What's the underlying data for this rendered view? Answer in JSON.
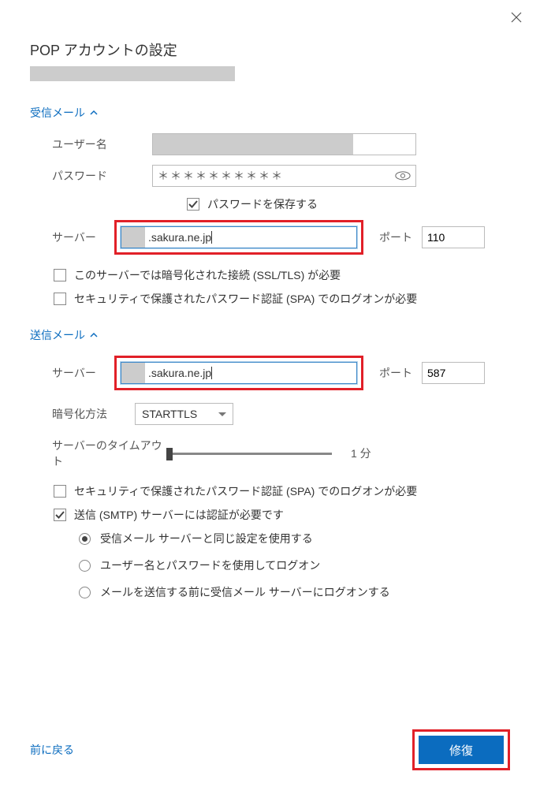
{
  "title": "POP アカウントの設定",
  "incoming": {
    "header": "受信メール",
    "username_label": "ユーザー名",
    "password_label": "パスワード",
    "password_value": "＊＊＊＊＊＊＊＊＊＊",
    "save_password_label": "パスワードを保存する",
    "server_label": "サーバー",
    "server_value": ".sakura.ne.jp",
    "port_label": "ポート",
    "port_value": "110",
    "ssl_required_label": "このサーバーでは暗号化された接続 (SSL/TLS) が必要",
    "spa_label": "セキュリティで保護されたパスワード認証 (SPA) でのログオンが必要"
  },
  "outgoing": {
    "header": "送信メール",
    "server_label": "サーバー",
    "server_value": ".sakura.ne.jp",
    "port_label": "ポート",
    "port_value": "587",
    "enc_label": "暗号化方法",
    "enc_value": "STARTTLS",
    "timeout_label": "サーバーのタイムアウト",
    "timeout_value": "1 分",
    "spa_label": "セキュリティで保護されたパスワード認証 (SPA) でのログオンが必要",
    "smtp_auth_label": "送信 (SMTP) サーバーには認証が必要です",
    "radio1": "受信メール サーバーと同じ設定を使用する",
    "radio2": "ユーザー名とパスワードを使用してログオン",
    "radio3": "メールを送信する前に受信メール サーバーにログオンする"
  },
  "footer": {
    "back": "前に戻る",
    "repair": "修復"
  }
}
